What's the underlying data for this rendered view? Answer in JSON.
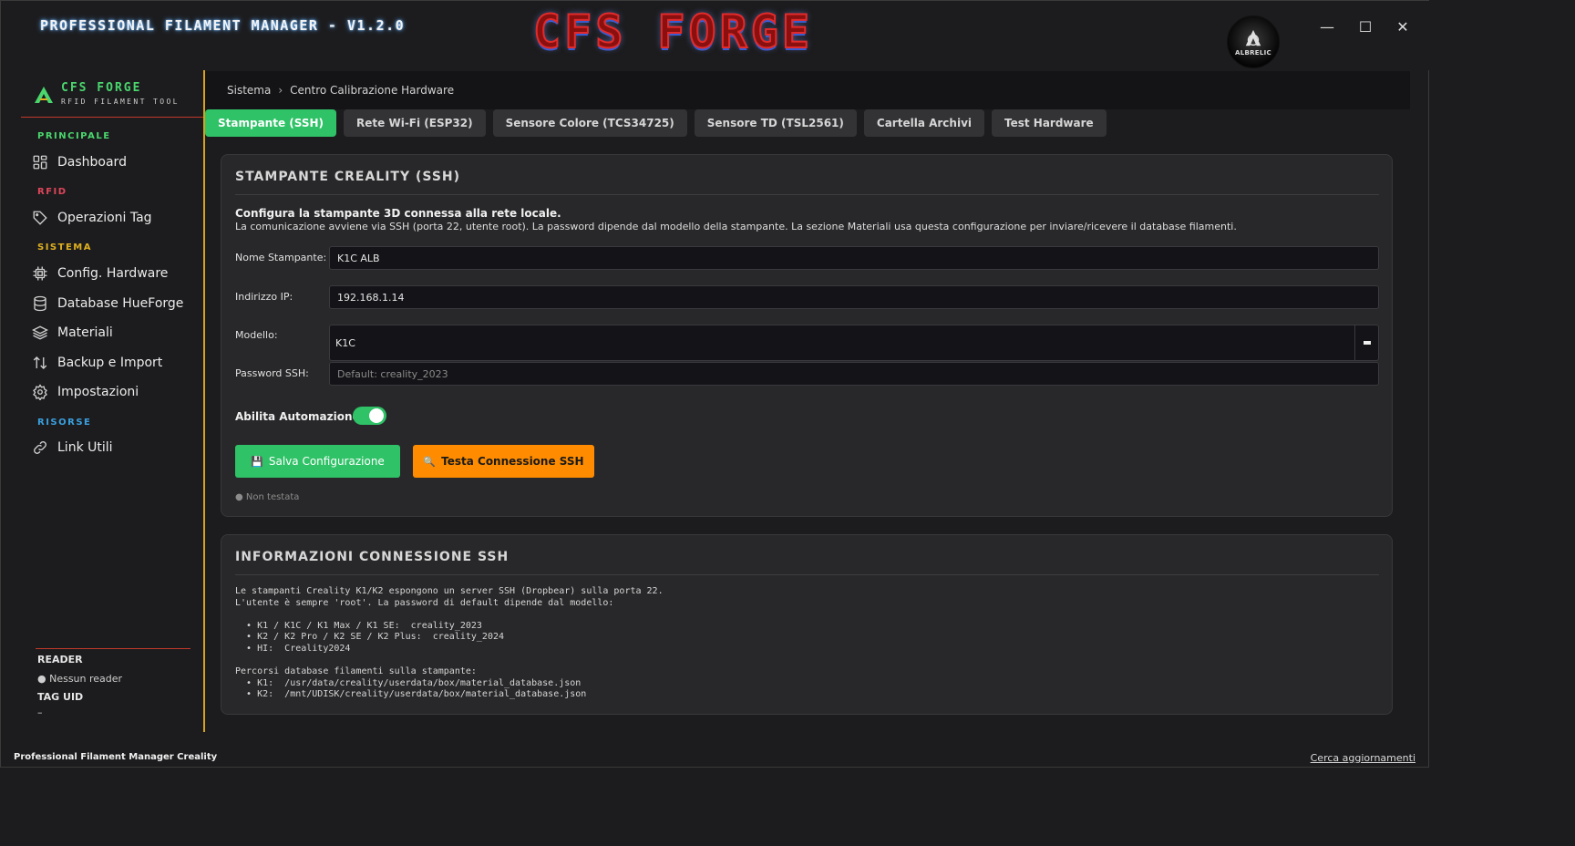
{
  "window": {
    "app_title": "PROFESSIONAL FILAMENT MANAGER - V1.2.0",
    "brand_logo": "CFS FORGE",
    "avatar_text": "ALBRELIC",
    "controls": {
      "minimize": "—",
      "maximize": "☐",
      "close": "✕"
    }
  },
  "sidebar": {
    "brand_name": "CFS FORGE",
    "brand_sub": "RFID FILAMENT TOOL",
    "sections": [
      {
        "label": "PRINCIPALE",
        "color": "#4ad66d",
        "items": [
          {
            "label": "Dashboard",
            "icon": "dashboard-icon"
          }
        ]
      },
      {
        "label": "RFID",
        "color": "#e0455a",
        "items": [
          {
            "label": "Operazioni Tag",
            "icon": "tag-icon"
          }
        ]
      },
      {
        "label": "SISTEMA",
        "color": "#e0b020",
        "items": [
          {
            "label": "Config. Hardware",
            "icon": "chip-icon"
          },
          {
            "label": "Database HueForge",
            "icon": "database-icon"
          },
          {
            "label": "Materiali",
            "icon": "layers-icon"
          },
          {
            "label": "Backup e Import",
            "icon": "transfer-icon"
          },
          {
            "label": "Impostazioni",
            "icon": "gear-icon"
          }
        ]
      },
      {
        "label": "RISORSE",
        "color": "#3aa0e0",
        "items": [
          {
            "label": "Link Utili",
            "icon": "link-icon"
          }
        ]
      }
    ],
    "reader_label": "READER",
    "reader_value": "● Nessun reader",
    "tag_uid_label": "TAG UID",
    "tag_uid_value": "–"
  },
  "breadcrumb": {
    "root": "Sistema",
    "sep": "›",
    "current": "Centro Calibrazione Hardware"
  },
  "tabs": [
    {
      "label": "Stampante (SSH)",
      "active": true
    },
    {
      "label": "Rete Wi-Fi (ESP32)",
      "active": false
    },
    {
      "label": "Sensore Colore (TCS34725)",
      "active": false
    },
    {
      "label": "Sensore TD (TSL2561)",
      "active": false
    },
    {
      "label": "Cartella Archivi",
      "active": false
    },
    {
      "label": "Test Hardware",
      "active": false
    }
  ],
  "printer_card": {
    "title": "STAMPANTE CREALITY (SSH)",
    "desc_strong": "Configura la stampante 3D connessa alla rete locale.",
    "desc_text": "La comunicazione avviene via SSH (porta 22, utente root). La password dipende dal modello della stampante. La sezione Materiali usa questa configurazione per inviare/ricevere il database filamenti.",
    "name_label": "Nome Stampante:",
    "name_value": "K1C ALB",
    "ip_label": "Indirizzo IP:",
    "ip_value": "192.168.1.14",
    "model_label": "Modello:",
    "model_value": "K1C",
    "password_label": "Password SSH:",
    "password_placeholder": "Default: creality_2023",
    "automation_label": "Abilita Automazione",
    "automation_on": true,
    "save_icon": "💾",
    "save_label": "Salva Configurazione",
    "test_icon": "🔍",
    "test_label": "Testa Connessione SSH",
    "status": "● Non testata"
  },
  "info_card": {
    "title": "INFORMAZIONI CONNESSIONE SSH",
    "body": "Le stampanti Creality K1/K2 espongono un server SSH (Dropbear) sulla porta 22.\nL'utente è sempre 'root'. La password di default dipende dal modello:\n\n  • K1 / K1C / K1 Max / K1 SE:  creality_2023\n  • K2 / K2 Pro / K2 SE / K2 Plus:  creality_2024\n  • HI:  Creality2024\n\nPercorsi database filamenti sulla stampante:\n  • K1:  /usr/data/creality/userdata/box/material_database.json\n  • K2:  /mnt/UDISK/creality/userdata/box/material_database.json"
  },
  "footer": {
    "left": "Professional Filament Manager Creality",
    "right": "Cerca aggiornamenti"
  }
}
